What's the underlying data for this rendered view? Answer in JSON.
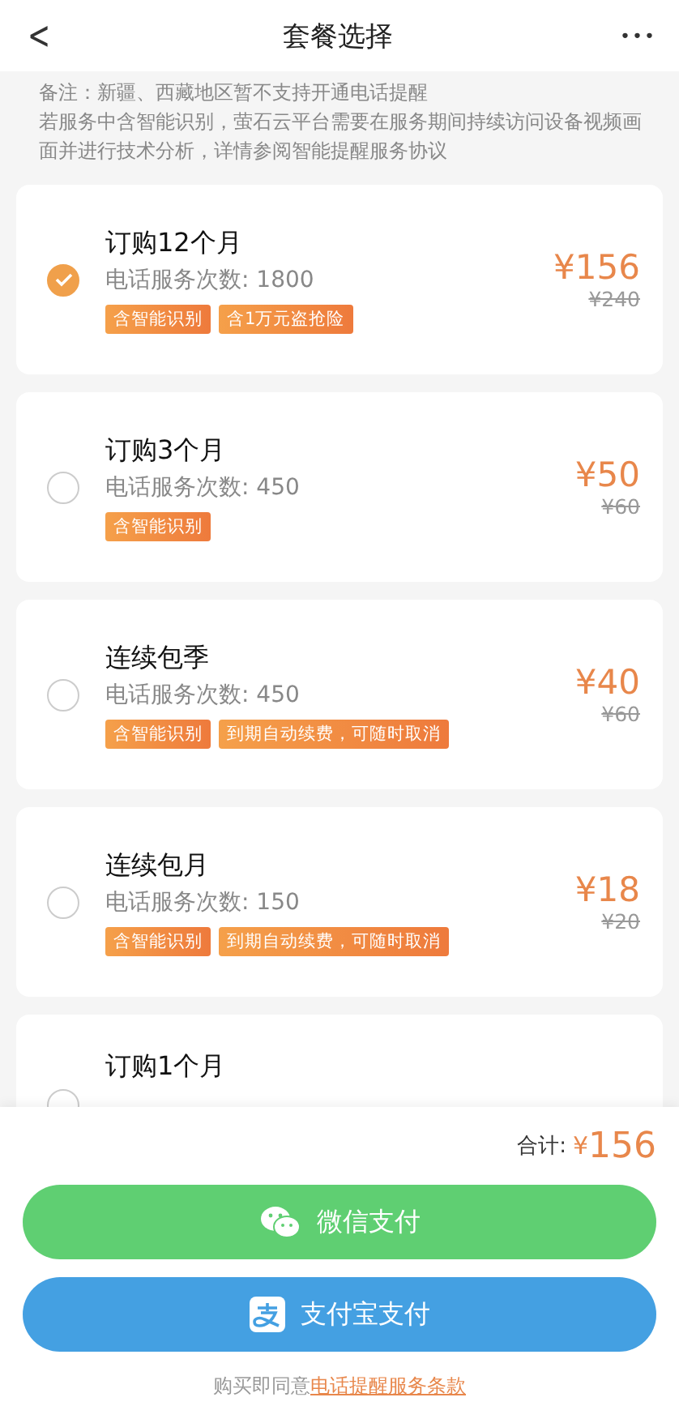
{
  "header": {
    "back": "<",
    "title": "套餐选择",
    "more": "•••"
  },
  "notes": [
    "备注：新疆、西藏地区暂不支持开通电话提醒",
    "若服务中含智能识别，萤石云平台需要在服务期间持续访问设备视频画面并进行技术分析，详情参阅智能提醒服务协议"
  ],
  "plans": [
    {
      "title": "订购12个月",
      "count": "电话服务次数: 1800",
      "tags": [
        "含智能识别",
        "含1万元盗抢险"
      ],
      "price": "¥156",
      "original_price": "¥240",
      "selected": true
    },
    {
      "title": "订购3个月",
      "count": "电话服务次数: 450",
      "tags": [
        "含智能识别"
      ],
      "price": "¥50",
      "original_price": "¥60",
      "selected": false
    },
    {
      "title": "连续包季",
      "count": "电话服务次数: 450",
      "tags": [
        "含智能识别",
        "到期自动续费，可随时取消"
      ],
      "price": "¥40",
      "original_price": "¥60",
      "selected": false
    },
    {
      "title": "连续包月",
      "count": "电话服务次数: 150",
      "tags": [
        "含智能识别",
        "到期自动续费，可随时取消"
      ],
      "price": "¥18",
      "original_price": "¥20",
      "selected": false
    },
    {
      "title": "订购1个月",
      "selected": false
    }
  ],
  "total": {
    "label": "合计:",
    "currency": "¥",
    "amount": "156"
  },
  "buttons": [
    {
      "kind": "wechat",
      "label": "微信支付"
    },
    {
      "kind": "alipay",
      "label": "支付宝支付"
    }
  ],
  "terms": {
    "text": "购买即同意",
    "link": "电话提醒服务条款"
  }
}
